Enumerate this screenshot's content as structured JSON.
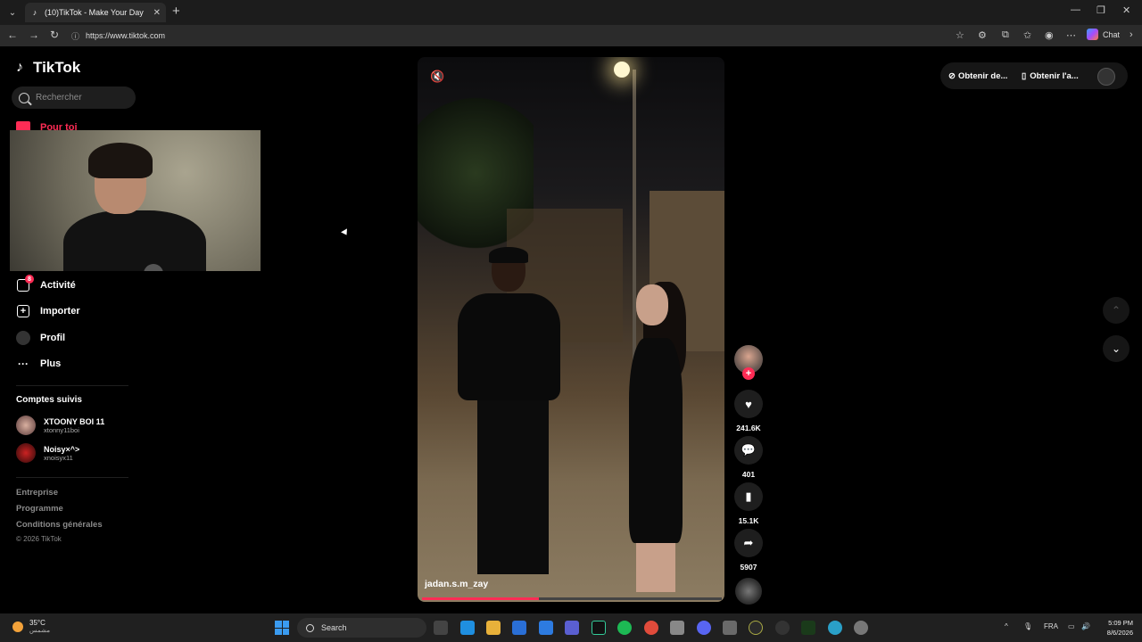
{
  "browser": {
    "tab_title": "(10)TikTok - Make Your Day",
    "url": "https://www.tiktok.com",
    "chat_label": "Chat"
  },
  "sidebar": {
    "logo": "TikTok",
    "search_placeholder": "Rechercher",
    "for_you": "Pour toi",
    "activity": "Activité",
    "activity_badge": "8",
    "import": "Importer",
    "profile": "Profil",
    "more": "Plus",
    "following_title": "Comptes suivis",
    "accounts": [
      {
        "name": "XTOONY BOI 11",
        "handle": "xtonny11boi"
      },
      {
        "name": "Noisy×^>",
        "handle": "xnoisyx11"
      }
    ],
    "footer": {
      "company": "Entreprise",
      "program": "Programme",
      "terms": "Conditions générales",
      "copyright": "© 2026 TikTok"
    }
  },
  "video": {
    "username": "jadan.s.m_zay",
    "progress": 0.39,
    "likes": "241.6K",
    "comments": "401",
    "saves": "15.1K",
    "shares": "5907"
  },
  "topbar": {
    "get_coins": "Obtenir de...",
    "get_app": "Obtenir l'a..."
  },
  "taskbar": {
    "temp": "35°C",
    "weather_desc": "مشمس",
    "search": "Search",
    "lang": "FRA",
    "time": "5:09 PM",
    "date": "8/6/2026"
  },
  "colors": {
    "accent": "#fe2c55"
  }
}
